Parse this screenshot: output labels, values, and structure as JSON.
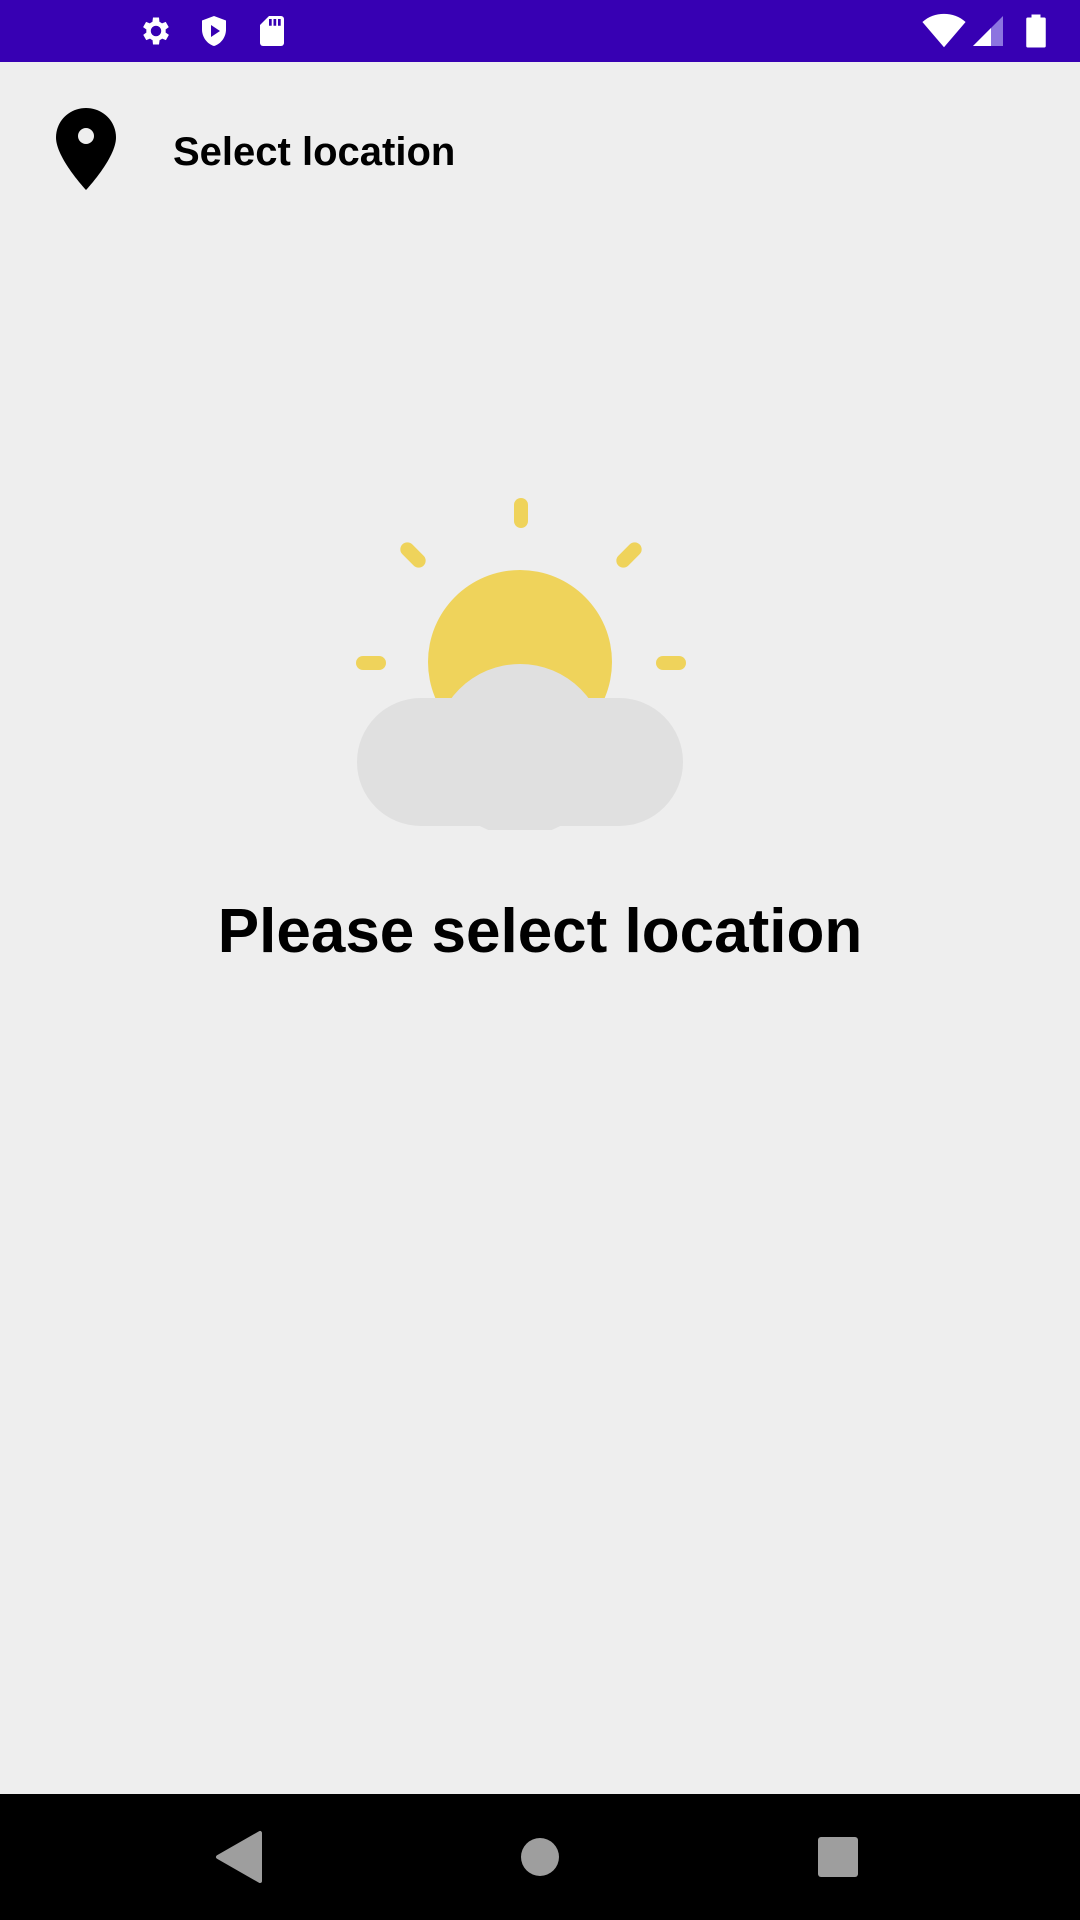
{
  "status_bar": {
    "background": "#3700b3",
    "left_icons": [
      "settings-icon",
      "shield-play-icon",
      "sd-card-icon"
    ],
    "right_icons": [
      "wifi-icon",
      "cell-signal-icon",
      "battery-icon"
    ]
  },
  "top_bar": {
    "icon": "location-pin-icon",
    "title": "Select location"
  },
  "empty_state": {
    "illustration": "partly-sunny-icon",
    "message": "Please select location",
    "colors": {
      "sun": "#efd35b",
      "cloud": "#e0e0e0"
    }
  },
  "nav_bar": {
    "buttons": [
      "back-icon",
      "home-icon",
      "recents-icon"
    ]
  }
}
